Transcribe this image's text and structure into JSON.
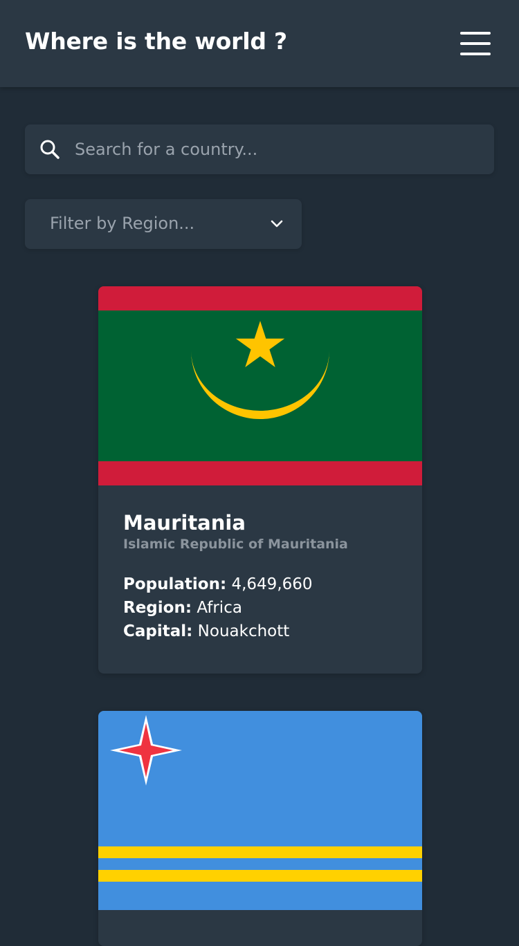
{
  "header": {
    "title": "Where is the world ?",
    "menu_icon": "hamburger-menu-icon"
  },
  "search": {
    "icon": "search-icon",
    "placeholder": "Search for a country...",
    "value": ""
  },
  "filter": {
    "label": "Filter by Region...",
    "icon": "chevron-down-icon"
  },
  "countries": [
    {
      "name": "Mauritania",
      "official_name": "Islamic Republic of Mauritania",
      "population_label": "Population:",
      "population": "4,649,660",
      "region_label": "Region:",
      "region": "Africa",
      "capital_label": "Capital:",
      "capital": "Nouakchott",
      "flag": "mauritania-flag"
    },
    {
      "flag": "aruba-flag"
    }
  ],
  "colors": {
    "background": "#202c37",
    "surface": "#2b3844",
    "text": "#ffffff",
    "muted_text": "#8b949d"
  }
}
